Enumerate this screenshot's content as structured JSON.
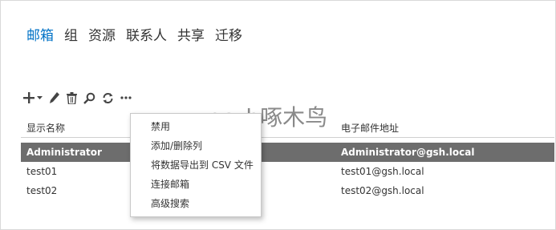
{
  "nav": {
    "items": [
      {
        "label": "邮箱",
        "active": true
      },
      {
        "label": "组"
      },
      {
        "label": "资源"
      },
      {
        "label": "联系人"
      },
      {
        "label": "共享"
      },
      {
        "label": "迁移"
      }
    ]
  },
  "toolbar": {
    "icons": [
      "add-icon",
      "pencil-icon",
      "trash-icon",
      "search-icon",
      "refresh-icon",
      "more-icon"
    ]
  },
  "watermark": "gs_h啄木鸟",
  "table": {
    "columns": [
      "显示名称",
      "电子邮件地址"
    ],
    "rows": [
      {
        "name": "Administrator",
        "email": "Administrator@gsh.local",
        "selected": true
      },
      {
        "name": "test01",
        "email": "test01@gsh.local"
      },
      {
        "name": "test02",
        "email": "test02@gsh.local"
      }
    ]
  },
  "context_menu": {
    "items": [
      "禁用",
      "添加/删除列",
      "将数据导出到 CSV 文件",
      "连接邮箱",
      "高级搜索"
    ]
  },
  "colors": {
    "accent": "#0072c6",
    "selected_row": "#6d6d6d"
  }
}
